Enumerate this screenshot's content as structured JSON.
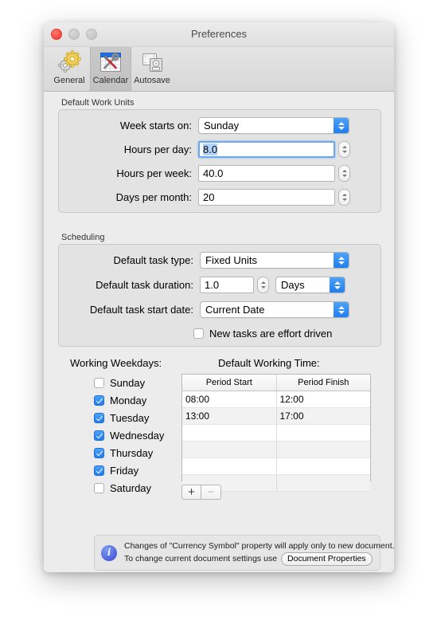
{
  "window": {
    "title": "Preferences",
    "traffic_lights": [
      "close",
      "minimize",
      "maximize"
    ]
  },
  "toolbar": {
    "items": [
      {
        "label": "General",
        "icon": "gears-icon",
        "selected": false
      },
      {
        "label": "Calendar",
        "icon": "calendar-tools-icon",
        "selected": true
      },
      {
        "label": "Autosave",
        "icon": "autosave-disk-icon",
        "selected": false
      }
    ]
  },
  "work_units": {
    "group_label": "Default Work Units",
    "week_starts_on": {
      "label": "Week starts on:",
      "value": "Sunday"
    },
    "hours_per_day": {
      "label": "Hours per day:",
      "value": "8.0",
      "focused": true
    },
    "hours_per_week": {
      "label": "Hours per week:",
      "value": "40.0"
    },
    "days_per_month": {
      "label": "Days per month:",
      "value": "20"
    }
  },
  "scheduling": {
    "group_label": "Scheduling",
    "task_type": {
      "label": "Default task type:",
      "value": "Fixed Units"
    },
    "task_duration": {
      "label": "Default task duration:",
      "value": "1.0",
      "unit": "Days"
    },
    "task_start_date": {
      "label": "Default task start date:",
      "value": "Current Date"
    },
    "effort_driven": {
      "label": "New tasks are effort driven",
      "checked": false
    }
  },
  "weekdays": {
    "title": "Working Weekdays:",
    "days": [
      {
        "label": "Sunday",
        "checked": false
      },
      {
        "label": "Monday",
        "checked": true
      },
      {
        "label": "Tuesday",
        "checked": true
      },
      {
        "label": "Wednesday",
        "checked": true
      },
      {
        "label": "Thursday",
        "checked": true
      },
      {
        "label": "Friday",
        "checked": true
      },
      {
        "label": "Saturday",
        "checked": false
      }
    ]
  },
  "working_time": {
    "title": "Default Working Time:",
    "columns": [
      "Period Start",
      "Period Finish"
    ],
    "rows": [
      [
        "08:00",
        "12:00"
      ],
      [
        "13:00",
        "17:00"
      ],
      [
        "",
        ""
      ],
      [
        "",
        ""
      ],
      [
        "",
        ""
      ],
      [
        "",
        ""
      ]
    ],
    "add_label": "+",
    "remove_label": "−"
  },
  "info": {
    "icon": "info-icon",
    "line1": "Changes of \"Currency Symbol\" property will apply only to new document.",
    "line2_prefix": "To change current document settings use",
    "button_label": "Document Properties"
  }
}
